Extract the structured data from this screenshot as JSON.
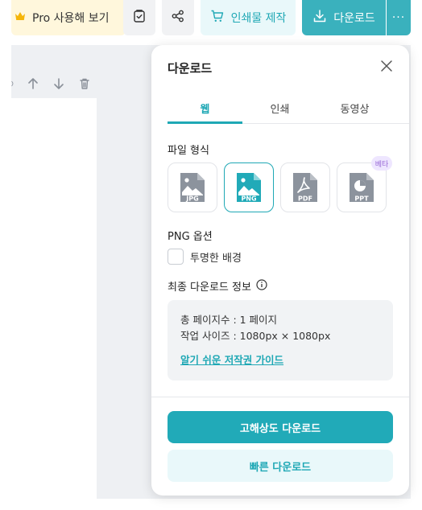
{
  "toolbar": {
    "pro_label": "Pro 사용해 보기",
    "print_label": "인쇄물 제작",
    "download_label": "다운로드",
    "more_label": "···"
  },
  "panel": {
    "title": "다운로드",
    "tabs": [
      {
        "label": "웹",
        "active": true
      },
      {
        "label": "인쇄",
        "active": false
      },
      {
        "label": "동영상",
        "active": false
      }
    ],
    "file_format_label": "파일 형식",
    "formats": [
      {
        "label": "JPG",
        "selected": false
      },
      {
        "label": "PNG",
        "selected": true
      },
      {
        "label": "PDF",
        "selected": false
      },
      {
        "label": "PPT",
        "selected": false,
        "badge": "베타"
      }
    ],
    "png_options_label": "PNG 옵션",
    "transparent_bg_label": "투명한 배경",
    "transparent_bg_checked": false,
    "final_info_label": "최종 다운로드 정보",
    "total_pages": "총 페이지수 : 1 페이지",
    "work_size": "작업 사이즈 : 1080px × 1080px",
    "copyright_guide": "알기 쉬운 저작권 가이드",
    "hq_download_label": "고해상도 다운로드",
    "fast_download_label": "빠른 다운로드"
  },
  "colors": {
    "accent": "#21aab8",
    "accent_light": "#e9f8fa",
    "pro_bg": "#fff7dc",
    "beta_bg": "#eee6ff"
  }
}
